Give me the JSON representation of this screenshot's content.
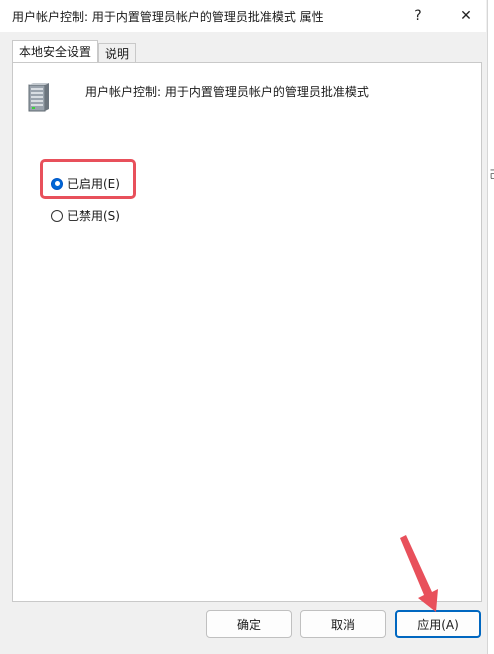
{
  "window": {
    "title": "用户帐户控制: 用于内置管理员帐户的管理员批准模式 属性",
    "help_glyph": "?",
    "close_glyph": "✕"
  },
  "tabs": [
    {
      "label": "本地安全设置",
      "active": true
    },
    {
      "label": "说明",
      "active": false
    }
  ],
  "policy": {
    "icon": "server-computer-icon",
    "name": "用户帐户控制: 用于内置管理员帐户的管理员批准模式"
  },
  "options": {
    "enabled_label": "已启用(E)",
    "disabled_label": "已禁用(S)",
    "selected": "enabled"
  },
  "buttons": {
    "ok": "确定",
    "cancel": "取消",
    "apply": "应用(A)"
  },
  "behind_window_fragment": "己",
  "annotation_color": "#e8505b",
  "accent": "#0067c0"
}
